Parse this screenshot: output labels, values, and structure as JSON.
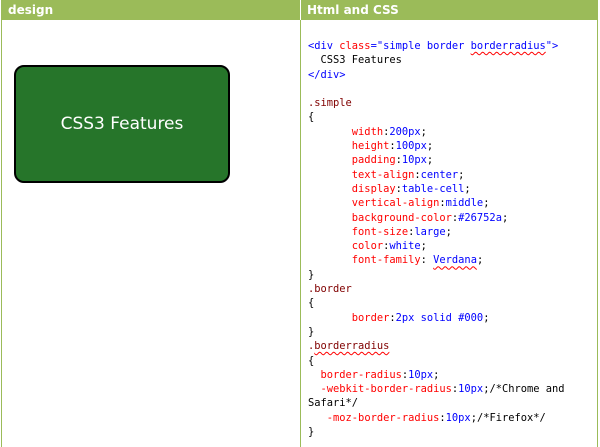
{
  "header": {
    "col_design": "design",
    "col_code": "Html and CSS"
  },
  "demo": {
    "label": "CSS3 Features"
  },
  "code": {
    "html_open_prefix": "<div ",
    "html_class_attr": "class",
    "html_class_value_pre": "=\"simple border ",
    "html_class_value_squiggle": "borderradius",
    "html_class_value_post": "\">",
    "html_text": "  CSS3 Features",
    "html_close": "</div>",
    "simple": {
      "selector": ".simple",
      "open": "{",
      "close": "}",
      "decls": [
        {
          "prop": "width",
          "value": "200px"
        },
        {
          "prop": "height",
          "value": "100px"
        },
        {
          "prop": "padding",
          "value": "10px"
        },
        {
          "prop": "text-align",
          "value": "center"
        },
        {
          "prop": "display",
          "value": "table-cell"
        },
        {
          "prop": "vertical-align",
          "value": "middle"
        },
        {
          "prop": "background-color",
          "value": "#26752a"
        },
        {
          "prop": "font-size",
          "value": "large"
        },
        {
          "prop": "color",
          "value": "white"
        },
        {
          "prop": "font-family",
          "value": " Verdana"
        }
      ]
    },
    "border": {
      "selector": ".border",
      "open": "{",
      "close": "}",
      "decls": [
        {
          "prop": "border",
          "value": "2px solid #000"
        }
      ]
    },
    "borderradius": {
      "selector_dot": ".",
      "selector_name": "borderradius",
      "open": "{",
      "close": "}",
      "line1_prop": "border-radius",
      "line1_value": "10px",
      "line2_prop": "-webkit-border-radius",
      "line2_value": "10px",
      "line2_comment": "/*Chrome and",
      "line2_wrap": "Safari*/",
      "line3_prop": "-moz-border-radius",
      "line3_value": "10px",
      "line3_comment": "/*Firefox*/"
    }
  },
  "colors": {
    "header_bg": "#9bbb59",
    "demo_bg": "#26752a",
    "selector": "#800000",
    "property": "#ff0000",
    "value": "#0000ff"
  }
}
